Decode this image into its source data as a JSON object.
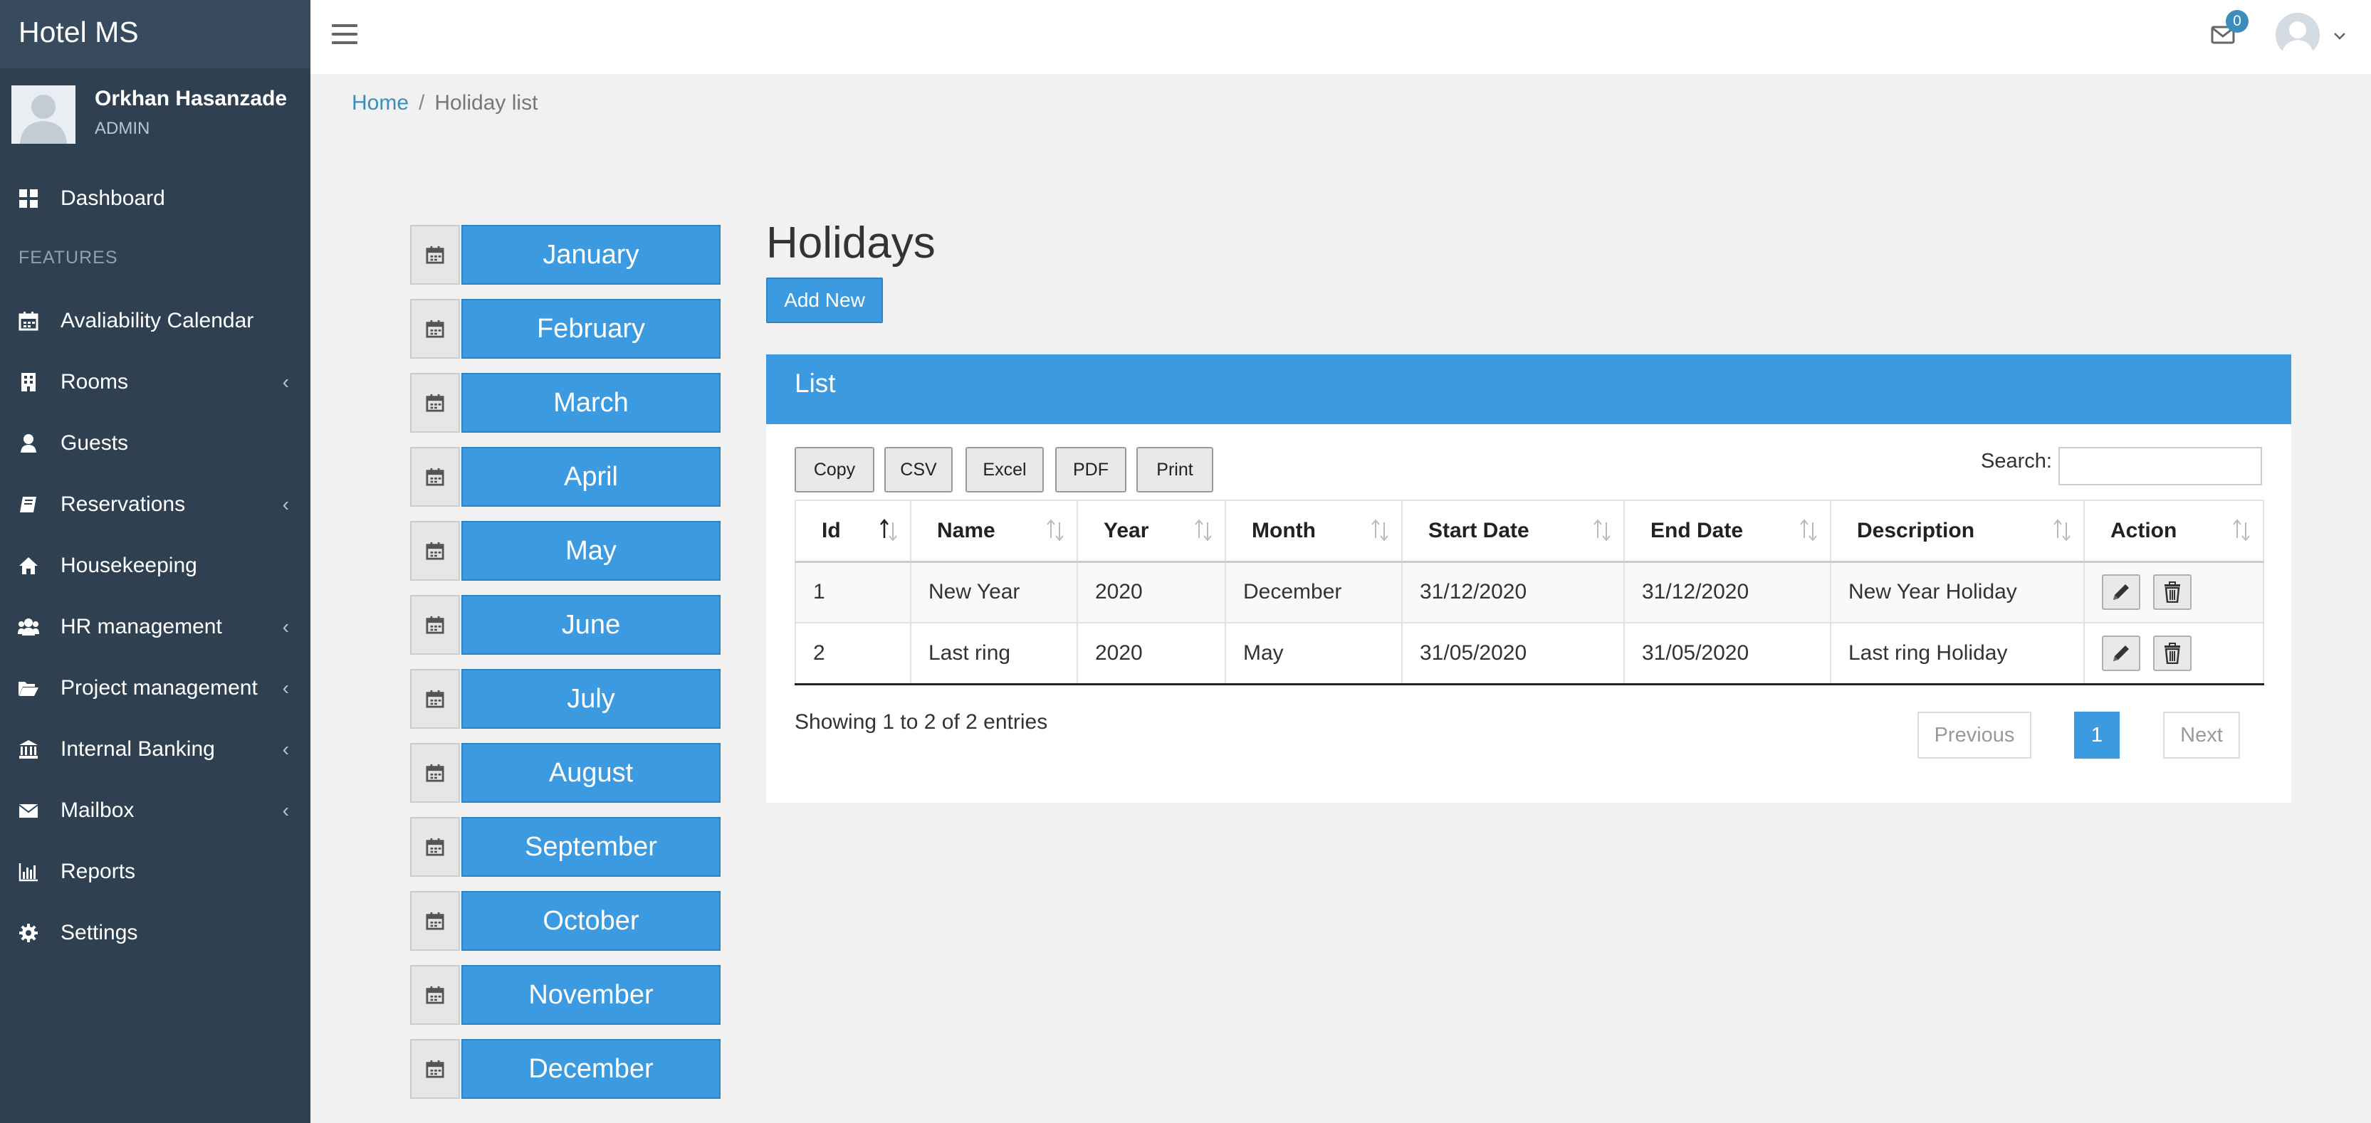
{
  "app": {
    "title": "Hotel MS"
  },
  "user": {
    "name": "Orkhan Hasanzade",
    "role": "ADMIN"
  },
  "sidebar": {
    "dashboard": "Dashboard",
    "features_header": "FEATURES",
    "items": [
      {
        "label": "Avaliability Calendar",
        "icon": "calendar-icon",
        "submenu": false
      },
      {
        "label": "Rooms",
        "icon": "building-icon",
        "submenu": true
      },
      {
        "label": "Guests",
        "icon": "user-icon",
        "submenu": false
      },
      {
        "label": "Reservations",
        "icon": "book-icon",
        "submenu": true
      },
      {
        "label": "Housekeeping",
        "icon": "home-icon",
        "submenu": false
      },
      {
        "label": "HR management",
        "icon": "users-icon",
        "submenu": true
      },
      {
        "label": "Project management",
        "icon": "folder-open-icon",
        "submenu": true
      },
      {
        "label": "Internal Banking",
        "icon": "bank-icon",
        "submenu": true
      },
      {
        "label": "Mailbox",
        "icon": "envelope-icon",
        "submenu": true
      },
      {
        "label": "Reports",
        "icon": "bar-chart-icon",
        "submenu": false
      },
      {
        "label": "Settings",
        "icon": "gear-icon",
        "submenu": false
      }
    ]
  },
  "topbar": {
    "mail_count": "0"
  },
  "breadcrumb": {
    "home": "Home",
    "current": "Holiday list"
  },
  "months": [
    "January",
    "February",
    "March",
    "April",
    "May",
    "June",
    "July",
    "August",
    "September",
    "October",
    "November",
    "December"
  ],
  "holidays": {
    "title": "Holidays",
    "add_new": "Add New",
    "list_title": "List",
    "export_buttons": [
      "Copy",
      "CSV",
      "Excel",
      "PDF",
      "Print"
    ],
    "search_label": "Search:",
    "search_value": "",
    "columns": [
      "Id",
      "Name",
      "Year",
      "Month",
      "Start Date",
      "End Date",
      "Description",
      "Action"
    ],
    "rows": [
      [
        "1",
        "New Year",
        "2020",
        "December",
        "31/12/2020",
        "31/12/2020",
        "New Year Holiday"
      ],
      [
        "2",
        "Last ring",
        "2020",
        "May",
        "31/05/2020",
        "31/05/2020",
        "Last ring Holiday"
      ]
    ],
    "info": "Showing 1 to 2 of 2 entries",
    "pagination": {
      "previous": "Previous",
      "current": "1",
      "next": "Next"
    }
  },
  "colors": {
    "sidebar": "#2f4050",
    "brand": "#374a5e",
    "accent": "#3c9be0"
  }
}
